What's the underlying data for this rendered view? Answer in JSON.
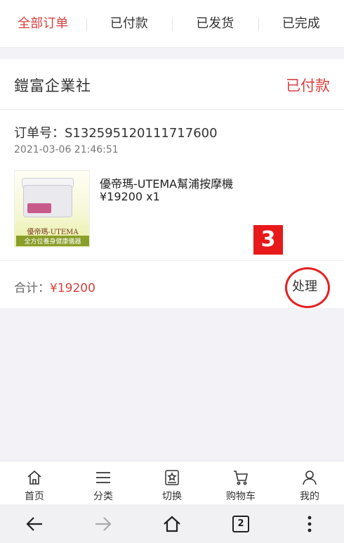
{
  "tabs": [
    {
      "label": "全部订单",
      "active": true
    },
    {
      "label": "已付款",
      "active": false
    },
    {
      "label": "已发货",
      "active": false
    },
    {
      "label": "已完成",
      "active": false
    }
  ],
  "order": {
    "shop_name": "鎧富企業社",
    "status": "已付款",
    "order_no_label": "订单号：",
    "order_no": "S132595120111717600",
    "time": "2021-03-06 21:46:51",
    "product": {
      "title": "優帝瑪-UTEMA幫浦按摩機",
      "price": "¥19200",
      "qty": "x1",
      "image_brand": "優帝瑪-UTEMA",
      "image_tagline": "全方位養身健康儀器"
    },
    "total_label": "合计：",
    "total_amount": "¥19200",
    "action_label": "处理"
  },
  "annotation": {
    "badge": "3"
  },
  "bottom_nav": [
    {
      "label": "首页",
      "icon": "home-icon"
    },
    {
      "label": "分类",
      "icon": "menu-icon"
    },
    {
      "label": "切换",
      "icon": "star-box-icon"
    },
    {
      "label": "购物车",
      "icon": "cart-icon"
    },
    {
      "label": "我的",
      "icon": "user-icon"
    }
  ],
  "system_bar": {
    "tab_count": "2"
  },
  "colors": {
    "accent": "#d9413f",
    "annotation_red": "#e32121"
  }
}
